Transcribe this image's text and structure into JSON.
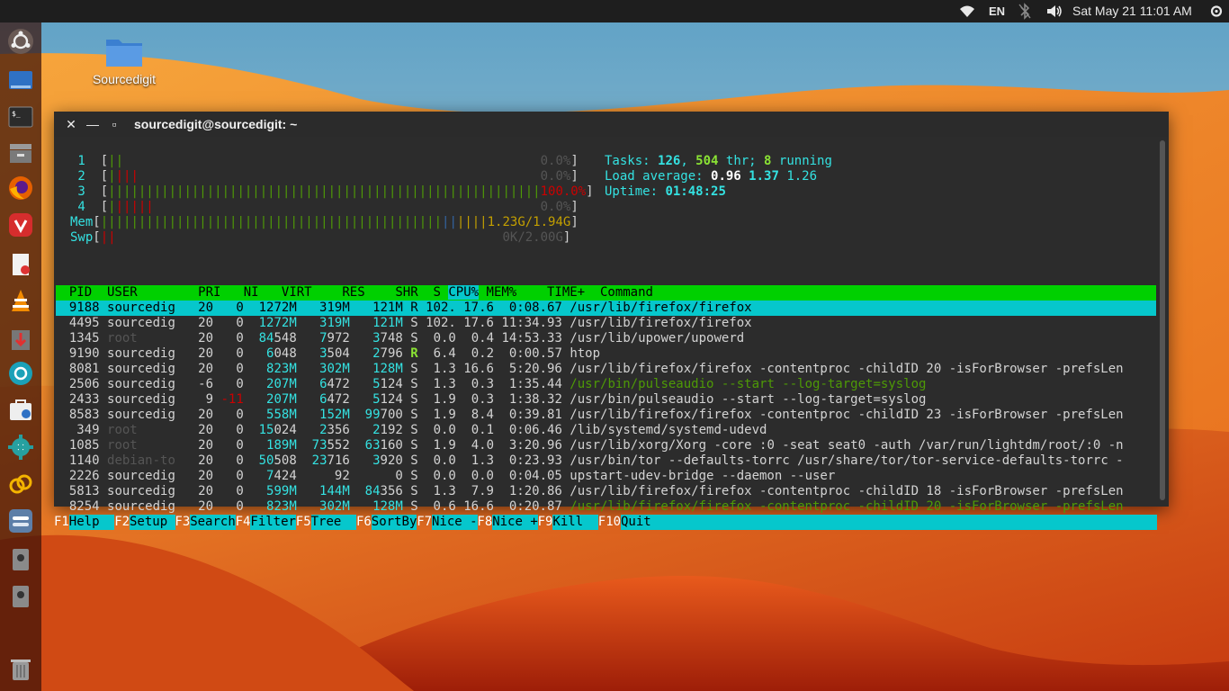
{
  "topbar": {
    "lang": "EN",
    "datetime": "Sat May 21  11:01 AM"
  },
  "launcher": {
    "items": [
      "ubuntu-logo-icon",
      "files-manager-icon",
      "terminal-icon",
      "archive-icon",
      "firefox-icon",
      "vivaldi-icon",
      "document-viewer-icon",
      "vlc-icon",
      "download-icon",
      "camera-app-icon",
      "software-icon",
      "settings-gear-icon",
      "link-app-icon",
      "toggle-app-icon",
      "disk-icon",
      "disk2-icon",
      "trash-icon"
    ]
  },
  "desktop": {
    "folder_label": "Sourcedigit"
  },
  "terminal": {
    "title": "sourcedigit@sourcedigit: ~"
  },
  "htop": {
    "meters": {
      "cpu1": {
        "num": "1",
        "bars": [
          [
            "||",
            "c-g"
          ]
        ],
        "pad": "                                                  ",
        "val": "0.0%"
      },
      "cpu2": {
        "num": "2",
        "bars": [
          [
            "|",
            "c-g"
          ],
          [
            "|||",
            "c-r"
          ]
        ],
        "pad": "                                                ",
        "val": "0.0%"
      },
      "cpu3": {
        "num": "3",
        "bars": [
          [
            "|||||||||||||||||||||||||||||||||||||||||||||||||||||||||",
            "c-g"
          ]
        ],
        "pad": "",
        "val": "100.0%"
      },
      "cpu4": {
        "num": "4",
        "bars": [
          [
            "|",
            "c-g"
          ],
          [
            "|||||",
            "c-r"
          ]
        ],
        "pad": "                                              ",
        "val": "0.0%"
      },
      "mem": {
        "label": "Mem",
        "bars": [
          [
            "|||||||||||||||||||||||||||||||||||||||||||||",
            "c-g"
          ],
          [
            "||",
            "c-b"
          ],
          [
            "||||",
            "c-y"
          ]
        ],
        "val": "1.23G/1.94G"
      },
      "swp": {
        "label": "Swp",
        "bars": [
          [
            "||",
            "c-r"
          ]
        ],
        "pad": "                                                ",
        "val": "0K/2.00G"
      }
    },
    "tasks": {
      "label": "Tasks: ",
      "tasks": "126",
      "sep": ", ",
      "thr": "504",
      "thr_label": " thr; ",
      "running": "8",
      "running_label": " running"
    },
    "load": {
      "label": "Load average: ",
      "l1": "0.96",
      "l5": "1.37",
      "l15": "1.26"
    },
    "uptime": {
      "label": "Uptime: ",
      "value": "01:48:25"
    },
    "header": {
      "pid": "  PID",
      "user": " USER     ",
      "pri": "  PRI",
      "ni": "  NI",
      "virt": "  VIRT",
      "res": "   RES",
      "shr": "   SHR",
      "s": " S",
      "cpu": "CPU%",
      "mem": " MEM%",
      "time": "   TIME+ ",
      "cmd": " Command"
    },
    "processes": [
      {
        "pid": "9188",
        "user": "sourcedig",
        "pri": "20",
        "ni": "0",
        "virt": "1272M",
        "res": "319M",
        "shr": "121M",
        "s": "R",
        "cpu": "102.",
        "mem": "17.6",
        "time": "0:08.67",
        "cmd": "/usr/lib/firefox/firefox",
        "sel": true
      },
      {
        "pid": "4495",
        "user": "sourcedig",
        "pri": "20",
        "ni": "0",
        "virt": "1272M",
        "res": "319M",
        "shr": "121M",
        "s": "S",
        "cpu": "102.",
        "mem": "17.6",
        "time": "11:34.93",
        "cmd": "/usr/lib/firefox/firefox"
      },
      {
        "pid": "1345",
        "user": "root",
        "pri": "20",
        "ni": "0",
        "virt": "84548",
        "res": "7972",
        "shr": "3748",
        "s": "S",
        "cpu": "0.0",
        "mem": "0.4",
        "time": "14:53.33",
        "cmd": "/usr/lib/upower/upowerd"
      },
      {
        "pid": "9190",
        "user": "sourcedig",
        "pri": "20",
        "ni": "0",
        "virt": "6048",
        "res": "3504",
        "shr": "2796",
        "s": "R",
        "cpu": "6.4",
        "mem": "0.2",
        "time": "0:00.57",
        "cmd": "htop"
      },
      {
        "pid": "8081",
        "user": "sourcedig",
        "pri": "20",
        "ni": "0",
        "virt": "823M",
        "res": "302M",
        "shr": "128M",
        "s": "S",
        "cpu": "1.3",
        "mem": "16.6",
        "time": "5:20.96",
        "cmd": "/usr/lib/firefox/firefox -contentproc -childID 20 -isForBrowser -prefsLen"
      },
      {
        "pid": "2506",
        "user": "sourcedig",
        "pri": "-6",
        "ni": "0",
        "virt": "207M",
        "res": "6472",
        "shr": "5124",
        "s": "S",
        "cpu": "1.3",
        "mem": "0.3",
        "time": "1:35.44",
        "cmd": "/usr/bin/pulseaudio --start --log-target=syslog",
        "thread": true
      },
      {
        "pid": "2433",
        "user": "sourcedig",
        "pri": "9",
        "ni": "-11",
        "virt": "207M",
        "res": "6472",
        "shr": "5124",
        "s": "S",
        "cpu": "1.9",
        "mem": "0.3",
        "time": "1:38.32",
        "cmd": "/usr/bin/pulseaudio --start --log-target=syslog"
      },
      {
        "pid": "8583",
        "user": "sourcedig",
        "pri": "20",
        "ni": "0",
        "virt": "558M",
        "res": "152M",
        "shr": "99700",
        "s": "S",
        "cpu": "1.9",
        "mem": "8.4",
        "time": "0:39.81",
        "cmd": "/usr/lib/firefox/firefox -contentproc -childID 23 -isForBrowser -prefsLen"
      },
      {
        "pid": "349",
        "user": "root",
        "pri": "20",
        "ni": "0",
        "virt": "15024",
        "res": "2356",
        "shr": "2192",
        "s": "S",
        "cpu": "0.0",
        "mem": "0.1",
        "time": "0:06.46",
        "cmd": "/lib/systemd/systemd-udevd"
      },
      {
        "pid": "1085",
        "user": "root",
        "pri": "20",
        "ni": "0",
        "virt": "189M",
        "res": "73552",
        "shr": "63160",
        "s": "S",
        "cpu": "1.9",
        "mem": "4.0",
        "time": "3:20.96",
        "cmd": "/usr/lib/xorg/Xorg -core :0 -seat seat0 -auth /var/run/lightdm/root/:0 -n"
      },
      {
        "pid": "1140",
        "user": "debian-tor",
        "pri": "20",
        "ni": "0",
        "virt": "50508",
        "res": "23716",
        "shr": "3920",
        "s": "S",
        "cpu": "0.0",
        "mem": "1.3",
        "time": "0:23.93",
        "cmd": "/usr/bin/tor --defaults-torrc /usr/share/tor/tor-service-defaults-torrc -"
      },
      {
        "pid": "2226",
        "user": "sourcedig",
        "pri": "20",
        "ni": "0",
        "virt": "7424",
        "res": "92",
        "shr": "0",
        "s": "S",
        "cpu": "0.0",
        "mem": "0.0",
        "time": "0:04.05",
        "cmd": "upstart-udev-bridge --daemon --user"
      },
      {
        "pid": "5813",
        "user": "sourcedig",
        "pri": "20",
        "ni": "0",
        "virt": "599M",
        "res": "144M",
        "shr": "84356",
        "s": "S",
        "cpu": "1.3",
        "mem": "7.9",
        "time": "1:20.86",
        "cmd": "/usr/lib/firefox/firefox -contentproc -childID 18 -isForBrowser -prefsLen"
      },
      {
        "pid": "8254",
        "user": "sourcedig",
        "pri": "20",
        "ni": "0",
        "virt": "823M",
        "res": "302M",
        "shr": "128M",
        "s": "S",
        "cpu": "0.6",
        "mem": "16.6",
        "time": "0:20.87",
        "cmd": "/usr/lib/firefox/firefox -contentproc -childID 20 -isForBrowser -prefsLen",
        "thread": true
      }
    ],
    "fkeys": [
      [
        "F1",
        "Help  "
      ],
      [
        "F2",
        "Setup "
      ],
      [
        "F3",
        "Search"
      ],
      [
        "F4",
        "Filter"
      ],
      [
        "F5",
        "Tree  "
      ],
      [
        "F6",
        "SortBy"
      ],
      [
        "F7",
        "Nice -"
      ],
      [
        "F8",
        "Nice +"
      ],
      [
        "F9",
        "Kill  "
      ],
      [
        "F10",
        "Quit  "
      ]
    ]
  },
  "colors": {
    "topbar": "#1e1e1e",
    "header_green": "#00d000",
    "selection_cyan": "#06c7cc",
    "terminal_bg": "#2c2c2c"
  }
}
